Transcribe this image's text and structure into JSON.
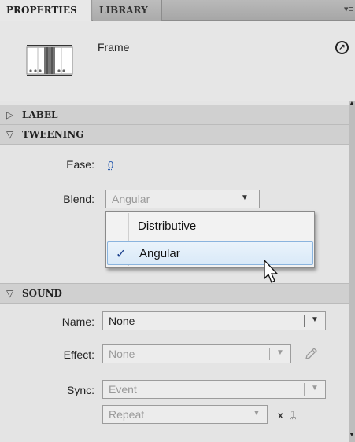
{
  "tabs": [
    {
      "label": "PROPERTIES",
      "active": true
    },
    {
      "label": "LIBRARY",
      "active": false
    }
  ],
  "panel_menu_icon": "panel-menu-icon",
  "header": {
    "type_label": "Frame",
    "help_icon": "link-arrow-icon"
  },
  "sections": {
    "label": {
      "title": "LABEL",
      "expanded": false
    },
    "tweening": {
      "title": "TWEENING",
      "expanded": true
    },
    "sound": {
      "title": "SOUND",
      "expanded": true
    }
  },
  "tweening": {
    "ease_label": "Ease:",
    "ease_value": "0",
    "blend_label": "Blend:",
    "blend_value": "Angular",
    "blend_options": [
      {
        "label": "Distributive",
        "checked": false
      },
      {
        "label": "Angular",
        "checked": true
      }
    ]
  },
  "sound": {
    "name_label": "Name:",
    "name_value": "None",
    "effect_label": "Effect:",
    "effect_value": "None",
    "sync_label": "Sync:",
    "sync_value": "Event",
    "repeat_value": "Repeat",
    "repeat_x": "x",
    "repeat_count": "1"
  },
  "colors": {
    "accent_link": "#2a5db0",
    "selection_border": "#8ab4de"
  }
}
